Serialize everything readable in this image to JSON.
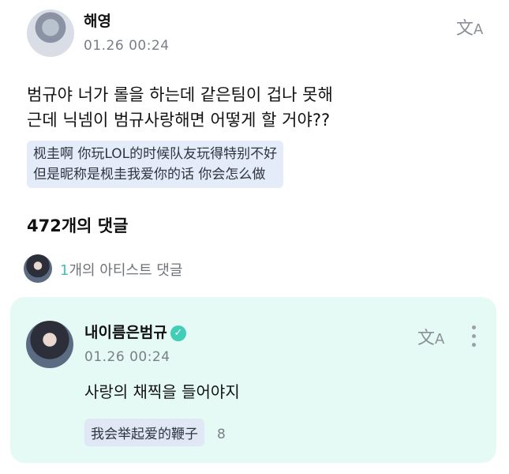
{
  "post": {
    "author": "해영",
    "timestamp": "01.26 00:24",
    "text_line1": "범규야 너가 롤을 하는데 같은팀이 겁나 못해",
    "text_line2": "근데 닉넴이 범규사랑해면 어떻게 할 거야??",
    "translation_line1": "枧圭啊 你玩LOL的时候队友玩得特别不好",
    "translation_line2": "但是昵称是枧圭我爱你的话 你会怎么做",
    "translate_icon": "translate-icon"
  },
  "comments": {
    "count_label": "472개의 댓글",
    "artist_count": "1",
    "artist_label": "개의 아티스트 댓글"
  },
  "reply": {
    "author": "내이름은범규",
    "verified_icon": "verified-check-icon",
    "timestamp": "01.26 00:24",
    "text": "사랑의 채찍을 들어야지",
    "translation": "我会举起爱的鞭子",
    "translation_count": "8"
  },
  "colors": {
    "card_background": "#e6faf5",
    "accent": "#42cdb7",
    "translation_background": "#e3ecf8"
  }
}
